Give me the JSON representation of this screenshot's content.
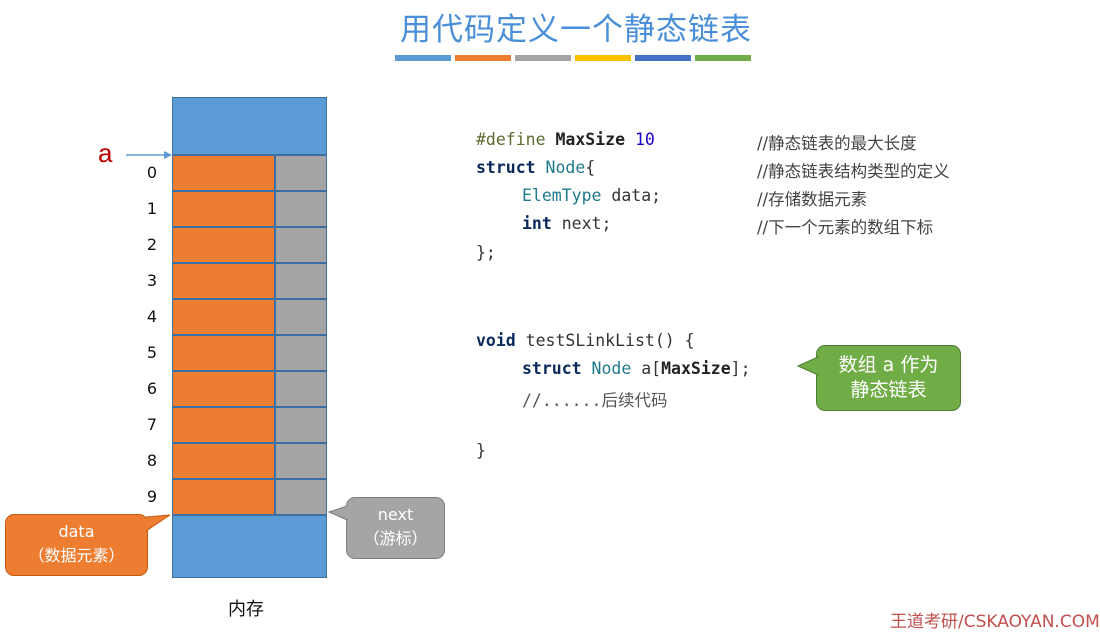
{
  "title": "用代码定义一个静态链表",
  "bar_colors": [
    "#5b9bd5",
    "#ed7d31",
    "#a5a5a5",
    "#ffc000",
    "#4472c4",
    "#70ad47"
  ],
  "diagram": {
    "pointer_label": "a",
    "indices": [
      "0",
      "1",
      "2",
      "3",
      "4",
      "5",
      "6",
      "7",
      "8",
      "9"
    ],
    "memory_label": "内存",
    "callout_data": {
      "line1": "data",
      "line2": "（数据元素）"
    },
    "callout_next": {
      "line1": "next",
      "line2": "（游标）"
    },
    "callout_array": {
      "line1": "数组 a 作为",
      "line2": "静态链表"
    }
  },
  "code": {
    "define_kw": "#define",
    "define_name": "MaxSize",
    "define_val": "10",
    "struct_kw": "struct",
    "struct_name": "Node",
    "struct_open": "{",
    "elem_type": "ElemType",
    "data_field": " data;",
    "int_kw": "int",
    "next_field": " next;",
    "struct_close": "};",
    "void_kw": "void",
    "func_sig": " testSLinkList() {",
    "decl_struct": "struct",
    "decl_node": "Node",
    "decl_a": " a[",
    "decl_max": "MaxSize",
    "decl_end": "];",
    "follow_comment": "//......后续代码",
    "func_close": "}"
  },
  "comments": [
    "//静态链表的最大长度",
    "//静态链表结构类型的定义",
    "//存储数据元素",
    "//下一个元素的数组下标"
  ],
  "watermark": "王道考研/CSKAOYAN.COM"
}
